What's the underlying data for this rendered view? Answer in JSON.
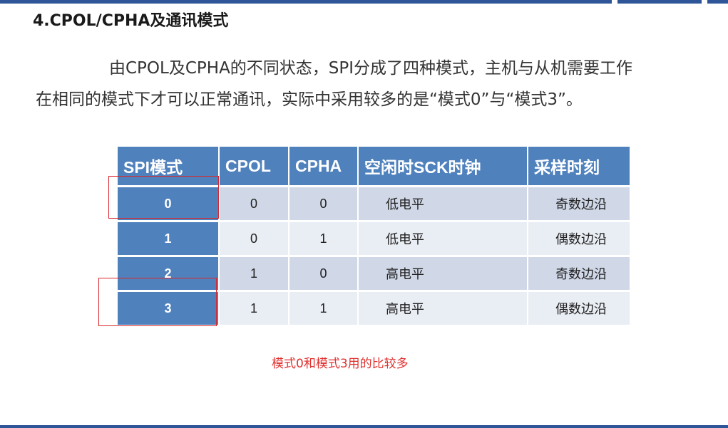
{
  "heading": "4.CPOL/CPHA及通讯模式",
  "paragraph": {
    "line1": "由CPOL及CPHA的不同状态，SPI分成了四种模式，主机与从机需要工作",
    "line2": "在相同的模式下才可以正常通讯，实际中采用较多的是“模式0”与“模式3”。"
  },
  "table": {
    "headers": [
      "SPI模式",
      "CPOL",
      "CPHA",
      "空闲时SCK时钟",
      "采样时刻"
    ],
    "rows": [
      {
        "mode": "0",
        "cpol": "0",
        "cpha": "0",
        "idle": "低电平",
        "sample": "奇数边沿"
      },
      {
        "mode": "1",
        "cpol": "0",
        "cpha": "1",
        "idle": "低电平",
        "sample": "偶数边沿"
      },
      {
        "mode": "2",
        "cpol": "1",
        "cpha": "0",
        "idle": "高电平",
        "sample": "奇数边沿"
      },
      {
        "mode": "3",
        "cpol": "1",
        "cpha": "1",
        "idle": "高电平",
        "sample": "偶数边沿"
      }
    ]
  },
  "note": "模式0和模式3用的比较多",
  "colors": {
    "accent": "#2e5597",
    "header_bg": "#4f81bd",
    "row_odd": "#d0d8e8",
    "row_even": "#e9edf4",
    "highlight": "#d9262c"
  }
}
